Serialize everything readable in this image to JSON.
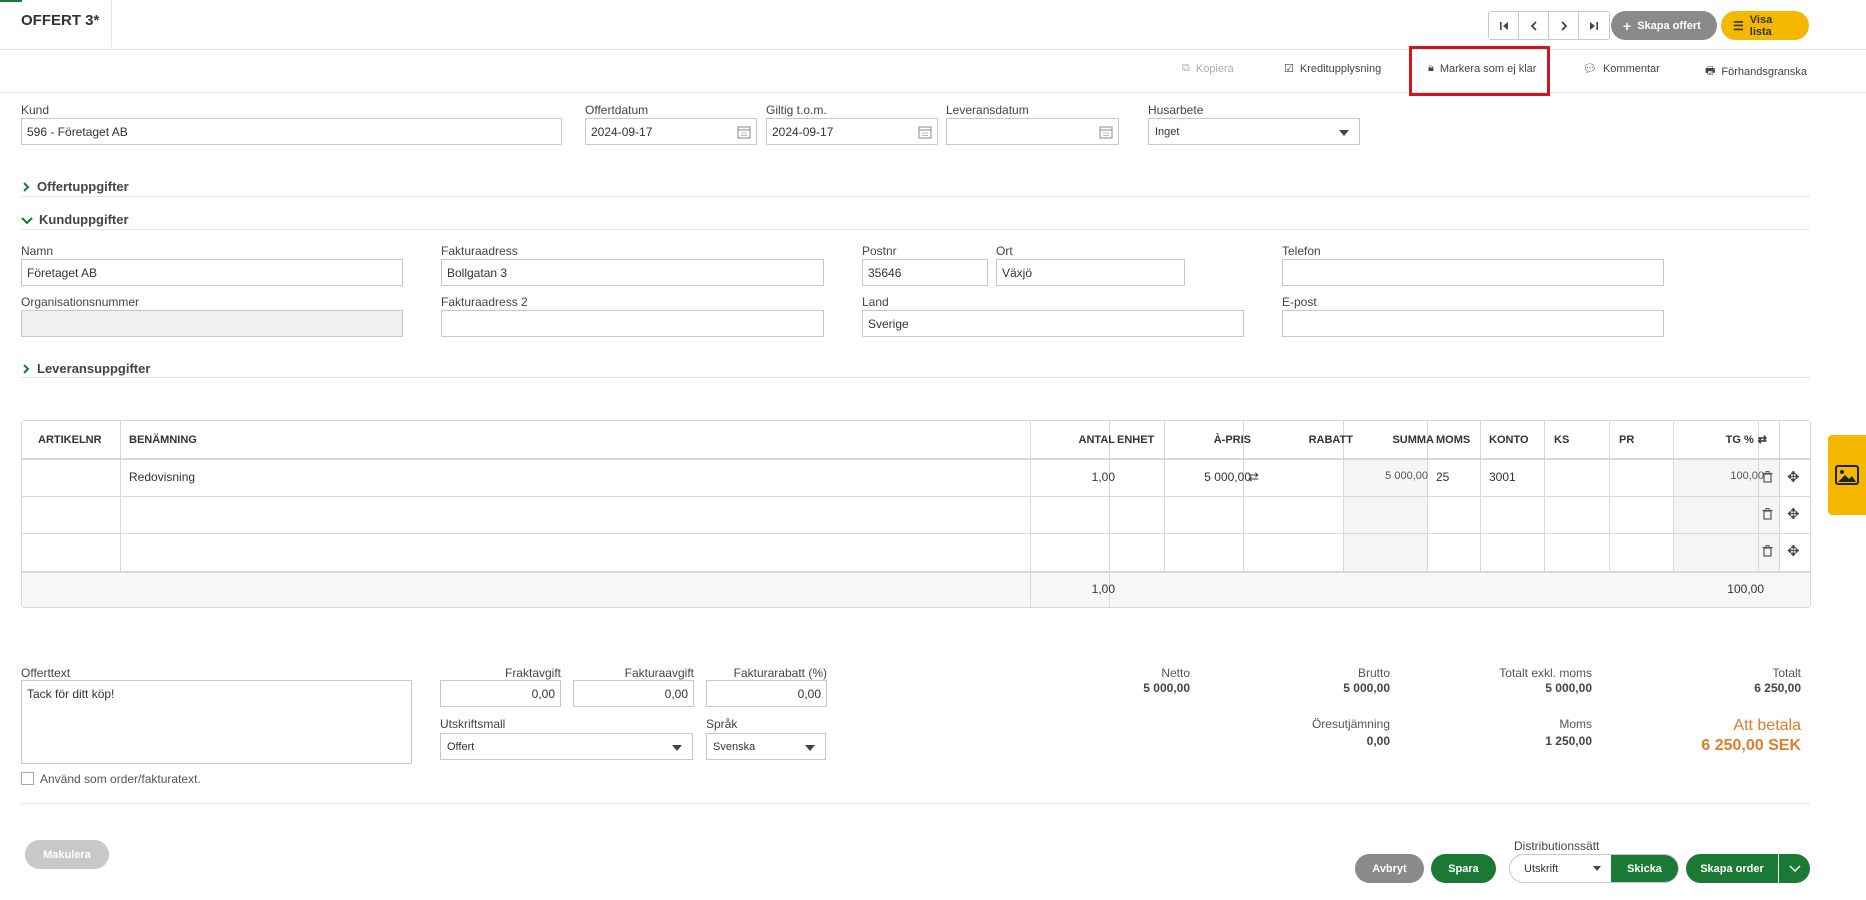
{
  "header": {
    "title": "OFFERT 3*",
    "create_offer_label": "Skapa offert",
    "show_list_label": "Visa lista"
  },
  "actions": {
    "copy": "Kopiera",
    "credit": "Kreditupplysning",
    "mark_not_ready": "Markera som ej klar",
    "comment": "Kommentar",
    "preview": "Förhandsgranska"
  },
  "top_fields": {
    "customer_label": "Kund",
    "customer_value": "596 - Företaget AB",
    "offer_date_label": "Offertdatum",
    "offer_date_value": "2024-09-17",
    "valid_label": "Giltig t.o.m.",
    "valid_value": "2024-09-17",
    "delivery_label": "Leveransdatum",
    "delivery_value": "",
    "housework_label": "Husarbete",
    "housework_value": "Inget"
  },
  "sections": {
    "offer": "Offertuppgifter",
    "customer": "Kunduppgifter",
    "delivery": "Leveransuppgifter"
  },
  "customer": {
    "name_label": "Namn",
    "name_value": "Företaget AB",
    "address_label": "Fakturaadress",
    "address_value": "Bollgatan 3",
    "postal_label": "Postnr",
    "postal_value": "35646",
    "city_label": "Ort",
    "city_value": "Växjö",
    "phone_label": "Telefon",
    "phone_value": "",
    "org_label": "Organisationsnummer",
    "org_value": "",
    "address2_label": "Fakturaadress 2",
    "address2_value": "",
    "country_label": "Land",
    "country_value": "Sverige",
    "email_label": "E-post",
    "email_value": ""
  },
  "table": {
    "headers": {
      "artno": "ARTIKELNR",
      "name": "BENÄMNING",
      "qty": "ANTAL",
      "unit": "ENHET",
      "price": "À-PRIS",
      "discount": "RABATT",
      "sum": "SUMMA",
      "vat": "MOMS",
      "account": "KONTO",
      "ks": "KS",
      "pr": "PR",
      "tg": "TG %"
    },
    "row1": {
      "artno": "",
      "name": "Redovisning",
      "qty": "1,00",
      "unit": "",
      "price": "5 000,00",
      "discount": "",
      "sum": "5 000,00",
      "vat": "25",
      "account": "3001",
      "ks": "",
      "pr": "",
      "tg": "100,00"
    },
    "footer": {
      "qty": "1,00",
      "tg": "100,00"
    }
  },
  "bottom": {
    "offer_text_label": "Offerttext",
    "offer_text_value": "Tack för ditt köp!",
    "use_as_order_label": "Använd som order/fakturatext.",
    "freight_label": "Fraktavgift",
    "freight_value": "0,00",
    "invoice_fee_label": "Fakturaavgift",
    "invoice_fee_value": "0,00",
    "discount_label": "Fakturarabatt (%)",
    "discount_value": "0,00",
    "template_label": "Utskriftsmall",
    "template_value": "Offert",
    "language_label": "Språk",
    "language_value": "Svenska"
  },
  "totals": {
    "netto_label": "Netto",
    "netto_value": "5 000,00",
    "brutto_label": "Brutto",
    "brutto_value": "5 000,00",
    "excl_label": "Totalt exkl. moms",
    "excl_value": "5 000,00",
    "total_label": "Totalt",
    "total_value": "6 250,00",
    "rounding_label": "Öresutjämning",
    "rounding_value": "0,00",
    "vat_label": "Moms",
    "vat_value": "1 250,00",
    "pay_label": "Att betala",
    "pay_value": "6 250,00 SEK"
  },
  "footer_bar": {
    "void_label": "Makulera",
    "cancel_label": "Avbryt",
    "save_label": "Spara",
    "distribution_label": "Distributionssätt",
    "distribution_value": "Utskrift",
    "send_label": "Skicka",
    "create_order_label": "Skapa order"
  },
  "colors": {
    "green": "#1a7a35",
    "yellow": "#f5b800",
    "grey": "#8a8a8a",
    "orange": "#e07b2a",
    "highlight": "#d0151f"
  }
}
